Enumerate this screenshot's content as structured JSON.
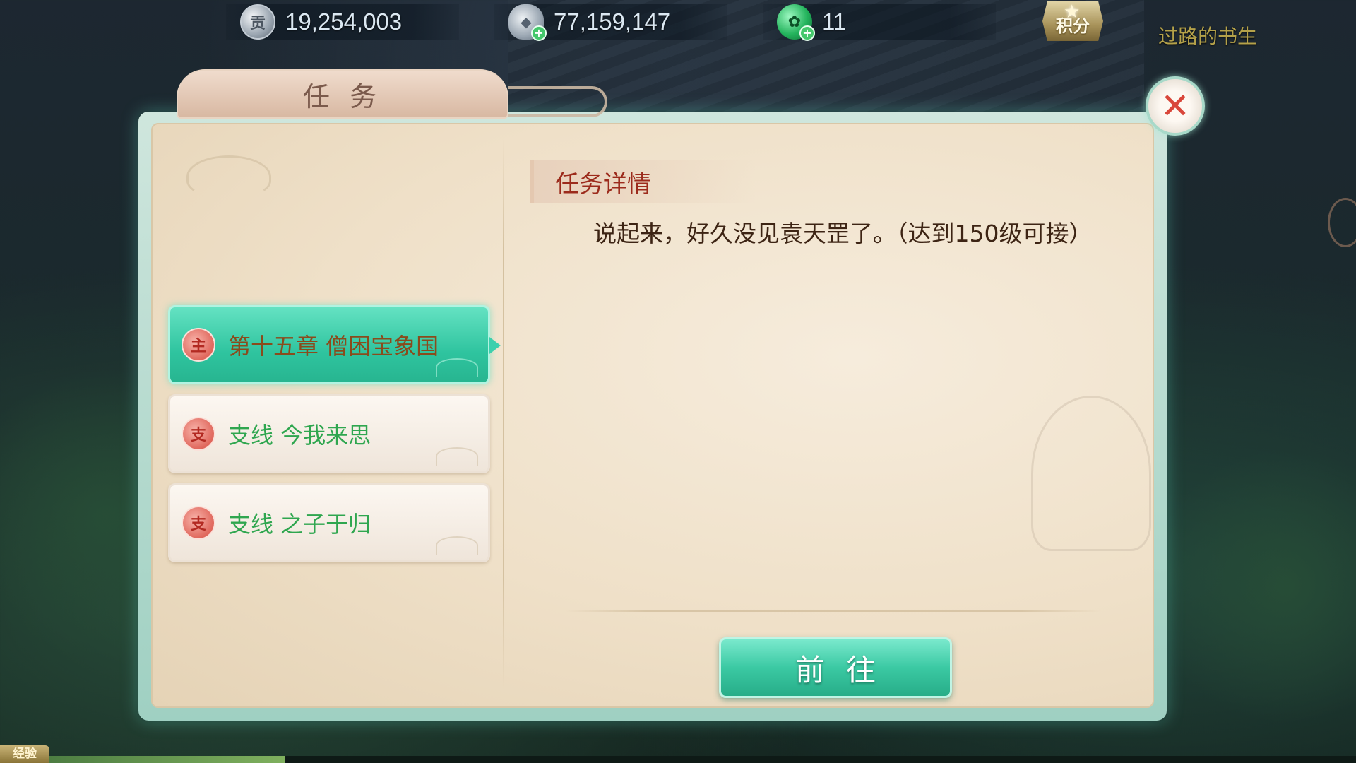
{
  "topbar": {
    "resources": [
      {
        "icon": "silver-coin-icon",
        "glyph": "贡",
        "value": "19,254,003",
        "has_plus": false
      },
      {
        "icon": "silver-ingot-icon",
        "glyph": "◆",
        "value": "77,159,147",
        "has_plus": true
      },
      {
        "icon": "jade-icon",
        "glyph": "✿",
        "value": "11",
        "has_plus": true
      }
    ],
    "points_label": "积分",
    "player_name": "过路的书生"
  },
  "dialog": {
    "title": "任务",
    "quests": [
      {
        "icon_glyph": "主",
        "label": "第十五章 僧困宝象国",
        "active": true
      },
      {
        "icon_glyph": "支",
        "label": "支线 今我来思",
        "active": false
      },
      {
        "icon_glyph": "支",
        "label": "支线 之子于归",
        "active": false
      }
    ],
    "detail": {
      "heading": "任务详情",
      "text": "说起来，好久没见袁天罡了。（达到150级可接）"
    },
    "goto_label": "前往"
  },
  "exp_label": "经验",
  "exp_progress": 0.18,
  "colors": {
    "accent": "#2fc49f",
    "close": "#d9463a",
    "quest_text": "#2fa64f",
    "active_quest_text": "#8a4b1c"
  }
}
